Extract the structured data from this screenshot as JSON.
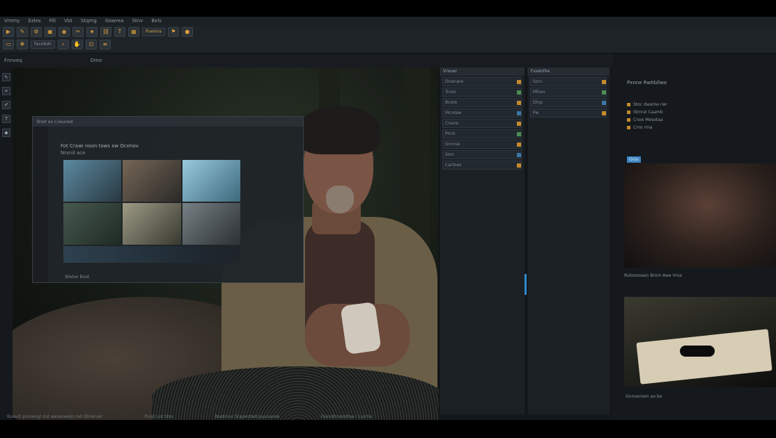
{
  "menubar": {
    "items": [
      "Vmmy",
      "Ezles",
      "Fill",
      "Vbt",
      "Stqmg",
      "Gowrea",
      "Stnv",
      "Bxls"
    ]
  },
  "toolbar": {
    "highlight": "Pvemra",
    "field1": "Faceboh"
  },
  "subbar": {
    "label": "Fnnveq",
    "right": "Dmo"
  },
  "floating_window": {
    "title": "Brwt ao Cveuned",
    "heading": "Fot Crawi noon tows xw Ocenov",
    "subheading": "Nrsnd ace",
    "footer": "Wwbw Boat"
  },
  "panels": {
    "p1_header": "Vrouer",
    "p1_rows": [
      "Dcwnare",
      "Tcoro",
      "Bcote",
      "Mcmlae",
      "Cnave",
      "Prrnt",
      "Grnvse",
      "Ssm",
      "Cartoes"
    ],
    "p2_header": "Fxxenlhe",
    "p2_rows": [
      "Sorv",
      "Mfoxs",
      "Dlnp",
      "Pw"
    ]
  },
  "right_panel": {
    "header": "Pxnne Rwhbllwe",
    "list": [
      "Stoc dwame rwr",
      "Stmrel Caamb",
      "Cnoe Mesotaa",
      "Cmo rma"
    ],
    "tag": "Gros",
    "mid": "Rutosooaan Brom Awe Vrsa",
    "foot": "Gnnverrem ao bo"
  },
  "status": {
    "left": "Ruasd) pmoengt ind awsanwelp rod Ollrwruer",
    "mid": "Puss) Lot Stm",
    "center": "Reatmov Stapeutwd puunaooe",
    "right": "Feevotmsslsfow / Lurrna"
  },
  "colors": {
    "accent": "#c58a2b",
    "blue": "#2f8bd0",
    "bg": "#14181c"
  },
  "icons": [
    "play-icon",
    "brush-icon",
    "gear-icon",
    "folder-icon",
    "eye-icon"
  ]
}
